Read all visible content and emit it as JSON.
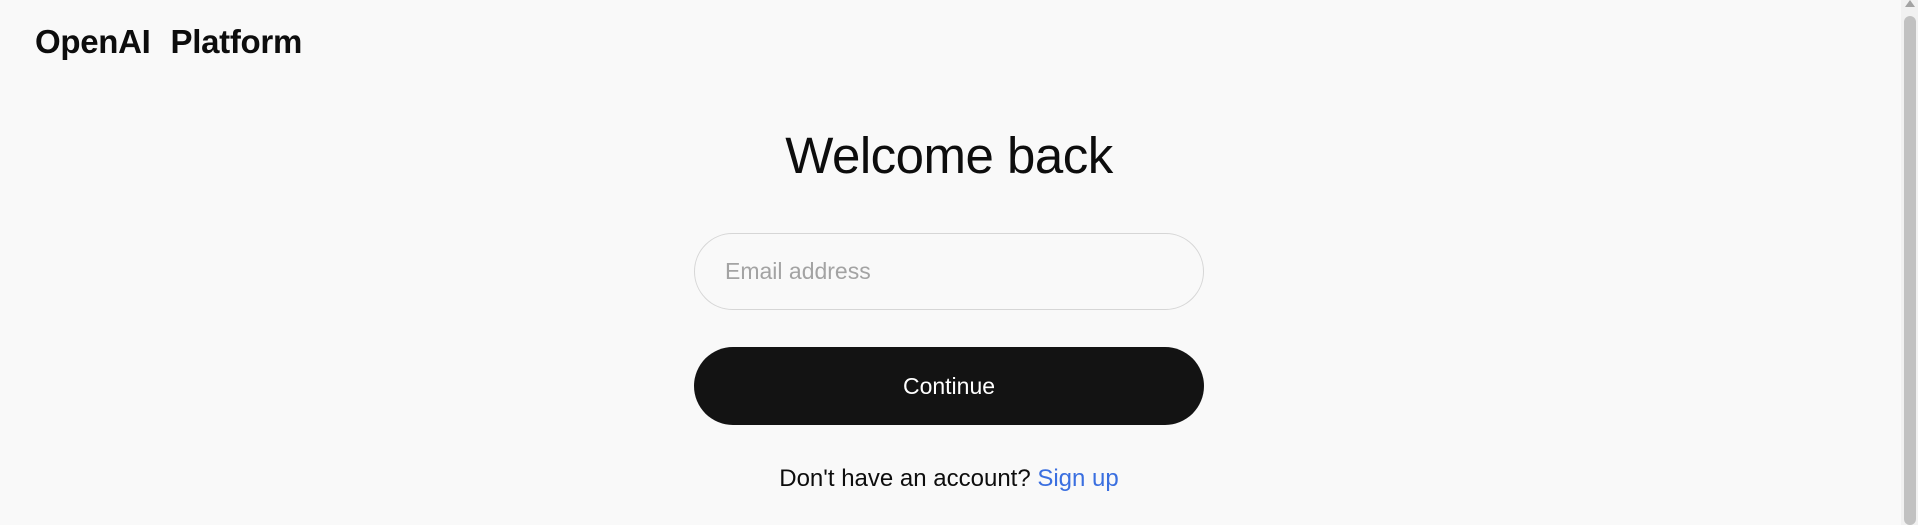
{
  "brand": {
    "name": "OpenAI",
    "product": "Platform"
  },
  "login": {
    "title": "Welcome back",
    "email_placeholder": "Email address",
    "email_value": "",
    "continue_label": "Continue",
    "signup_prompt": "Don't have an account?",
    "signup_link": "Sign up"
  },
  "colors": {
    "background": "#f9f9f9",
    "button": "#131313",
    "link": "#3a6fe0",
    "placeholder": "#a3a3a3"
  }
}
